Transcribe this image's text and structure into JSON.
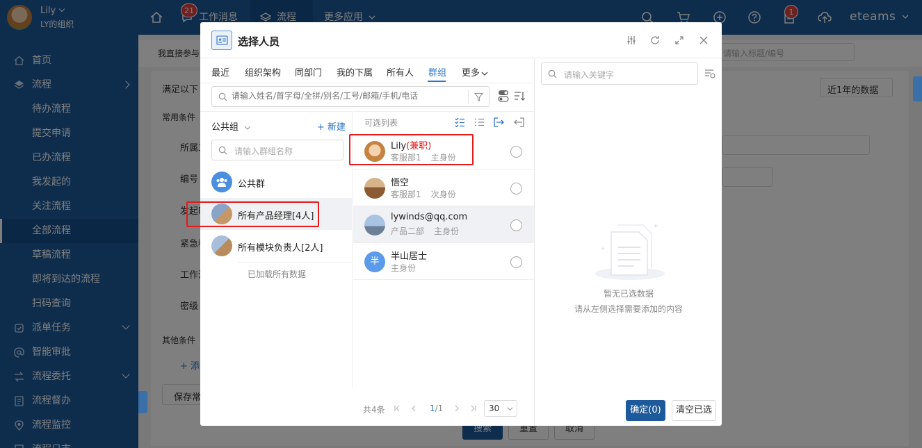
{
  "topbar": {
    "user_name": "Lily",
    "user_org": "LY的组织",
    "nav": [
      {
        "label": "工作消息",
        "badge": "21"
      },
      {
        "label": "流程"
      },
      {
        "label": "更多应用"
      }
    ],
    "doc_badge": "1",
    "brand": "eteams"
  },
  "sidebar": {
    "items": [
      {
        "label": "首页",
        "icon": "home-icon"
      },
      {
        "label": "流程",
        "icon": "layers-icon"
      },
      {
        "label": "待办流程"
      },
      {
        "label": "提交申请"
      },
      {
        "label": "已办流程"
      },
      {
        "label": "我发起的"
      },
      {
        "label": "关注流程"
      },
      {
        "label": "全部流程"
      },
      {
        "label": "草稿流程"
      },
      {
        "label": "即将到达的流程"
      },
      {
        "label": "扫码查询"
      },
      {
        "label": "派单任务",
        "icon": "dispatch-icon"
      },
      {
        "label": "智能审批",
        "icon": "at-icon"
      },
      {
        "label": "流程委托",
        "icon": "delegate-icon"
      },
      {
        "label": "流程督办",
        "icon": "supervise-icon"
      },
      {
        "label": "流程监控",
        "icon": "monitor-icon"
      },
      {
        "label": "流程日志",
        "icon": "log-icon"
      }
    ]
  },
  "background": {
    "breadcrumb": "我直接参与",
    "filter_label": "满足以下",
    "common_conditions": "常用条件",
    "fields": [
      "所属工",
      "编号",
      "发起时",
      "紧急程",
      "工作流",
      "密级"
    ],
    "other_conditions": "其他条件",
    "add_label": "+ 添加",
    "save_label": "保存常",
    "search_placeholder": "请输入标题/编号",
    "date_filter": "近1年的数据",
    "search_button": "搜索",
    "reset_button": "重置",
    "cancel_button": "取消"
  },
  "modal": {
    "title": "选择人员",
    "tabs": [
      "最近",
      "组织架构",
      "同部门",
      "我的下属",
      "所有人",
      "群组",
      "更多"
    ],
    "active_tab": "群组",
    "search_placeholder": "请输入姓名/首字母/全拼/别名/工号/邮箱/手机/电话",
    "group_dropdown": "公共组",
    "new_label": "+ 新建",
    "group_search_placeholder": "请输入群组名称",
    "groups": [
      {
        "label": "公共群"
      },
      {
        "label": "所有产品经理[4人]"
      },
      {
        "label": "所有模块负责人[2人]"
      }
    ],
    "loaded_all": "已加载所有数据",
    "list_title": "可选列表",
    "people": [
      {
        "name": "Lily",
        "tag": "(兼职)",
        "dept": "客服部1",
        "role": "主身份"
      },
      {
        "name": "悟空",
        "tag": "",
        "dept": "客服部1",
        "role": "次身份"
      },
      {
        "name": "lywinds@qq.com",
        "tag": "",
        "dept": "产品二部",
        "role": "主身份"
      },
      {
        "name": "半山居士",
        "tag": "",
        "dept": "",
        "role": "主身份",
        "initial": "半"
      }
    ],
    "pagination": {
      "total": "共4条",
      "page": "1",
      "pages": "/1",
      "page_size": "30"
    },
    "right_search_placeholder": "请输入关键字",
    "empty_title": "暂无已选数据",
    "empty_hint": "请从左侧选择需要添加的内容",
    "confirm_button": "确定(0)",
    "clear_button": "清空已选"
  },
  "colors": {
    "brand_blue": "#1d5a9b",
    "accent": "#2a74c6",
    "highlight_red": "#e21b1b"
  }
}
